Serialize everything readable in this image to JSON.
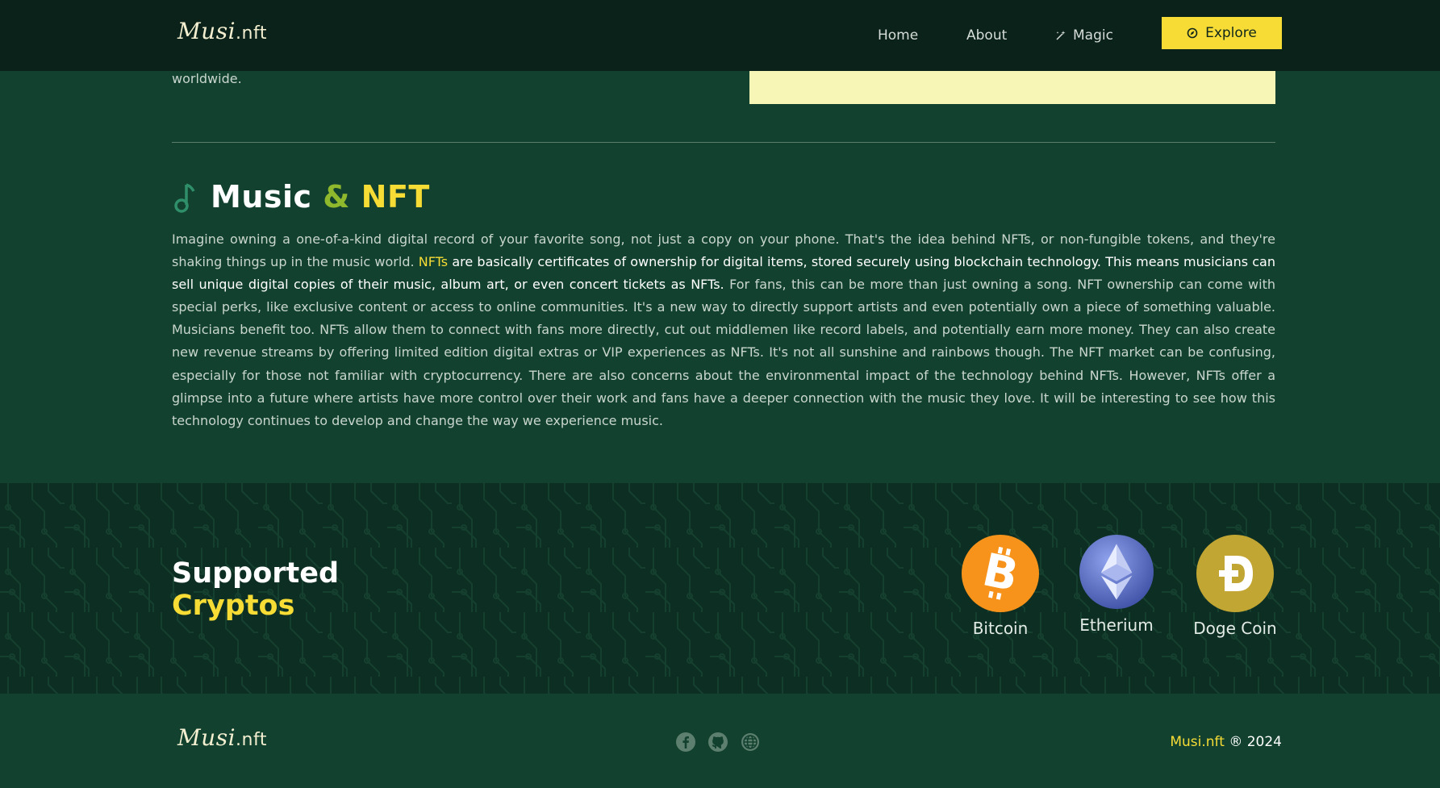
{
  "header": {
    "logo_script": "Musi",
    "logo_suffix": ".nft",
    "nav": [
      {
        "label": "Home",
        "icon": ""
      },
      {
        "label": "About",
        "icon": ""
      },
      {
        "label": "Magic",
        "icon": "magic-wand-icon"
      }
    ],
    "cta": {
      "label": "Explore",
      "icon": "compass-icon"
    }
  },
  "intro": {
    "text_tail": "guitars, our catalog is a testament to the boundless creativity of artists worldwide."
  },
  "music_nft": {
    "icon": "music-note-icon",
    "title_part1": "Music",
    "title_amp": "&",
    "title_part2": "NFT",
    "p1": "Imagine owning a one-of-a-kind digital record of your favorite song, not just a copy on your phone. That's the idea behind NFTs, or non-fungible tokens, and they're shaking things up in the music world.",
    "p_hl": "NFTs",
    "p_bright": "are basically certificates of ownership for digital items, stored securely using blockchain technology. This means musicians can sell unique digital copies of their music, album art, or even concert tickets as NFTs.",
    "p_rest": "For fans, this can be more than just owning a song. NFT ownership can come with special perks, like exclusive content or access to online communities. It's a new way to directly support artists and even potentially own a piece of something valuable. Musicians benefit too. NFTs allow them to connect with fans more directly, cut out middlemen like record labels, and potentially earn more money. They can also create new revenue streams by offering limited edition digital extras or VIP experiences as NFTs. It's not all sunshine and rainbows though. The NFT market can be confusing, especially for those not familiar with cryptocurrency. There are also concerns about the environmental impact of the technology behind NFTs. However, NFTs offer a glimpse into a future where artists have more control over their work and fans have a deeper connection with the music they love. It will be interesting to see how this technology continues to develop and change the way we experience music."
  },
  "cryptos": {
    "title_line1": "Supported",
    "title_line2": "Cryptos",
    "coins": [
      {
        "name": "Bitcoin",
        "icon": "bitcoin-icon",
        "color": "#f7931a"
      },
      {
        "name": "Etherium",
        "icon": "ethereum-icon",
        "color": "#627eea"
      },
      {
        "name": "Doge Coin",
        "icon": "dogecoin-icon",
        "color": "#c2a633"
      }
    ]
  },
  "footer": {
    "logo_script": "Musi",
    "logo_suffix": ".nft",
    "socials": [
      "facebook-icon",
      "github-icon",
      "globe-icon"
    ],
    "copyright_brand": "Musi.nft",
    "copyright_rest": "® 2024"
  },
  "colors": {
    "accent": "#f6dc35",
    "bg": "#12412f",
    "header_bg": "#0a2219"
  }
}
